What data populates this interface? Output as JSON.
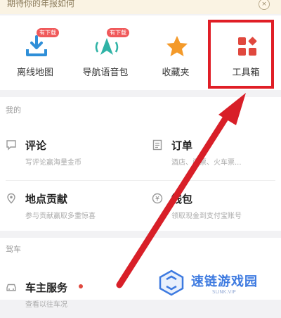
{
  "banner": {
    "text": "期待你的年报如何",
    "close_glyph": "×"
  },
  "quick_actions": [
    {
      "label": "离线地图",
      "badge": "有下载",
      "icon": "download-icon"
    },
    {
      "label": "导航语音包",
      "badge": "有下载",
      "icon": "voice-nav-icon"
    },
    {
      "label": "收藏夹",
      "icon": "star-icon"
    },
    {
      "label": "工具箱",
      "icon": "toolbox-icon"
    }
  ],
  "mine": {
    "title": "我的",
    "items": [
      {
        "title": "评论",
        "subtitle": "写评论赢海量金币",
        "icon": "comment-icon"
      },
      {
        "title": "订单",
        "subtitle": "酒店、门票、火车票...",
        "icon": "order-icon"
      },
      {
        "title": "地点贡献",
        "subtitle": "参与贡献赢取多重惊喜",
        "icon": "location-pin-icon"
      },
      {
        "title": "钱包",
        "subtitle": "领取现金到支付宝账号",
        "icon": "wallet-icon"
      }
    ]
  },
  "driving": {
    "title": "驾车",
    "items": [
      {
        "title": "车主服务",
        "subtitle": "查看以往车况",
        "icon": "car-icon"
      }
    ]
  },
  "watermark": {
    "text": "速链游戏园",
    "sub": "SLINK.VIP"
  },
  "colors": {
    "accent_red": "#e01e26",
    "teal": "#2fb3a6",
    "star_orange": "#f49a2a",
    "tool_red": "#e0483e"
  }
}
